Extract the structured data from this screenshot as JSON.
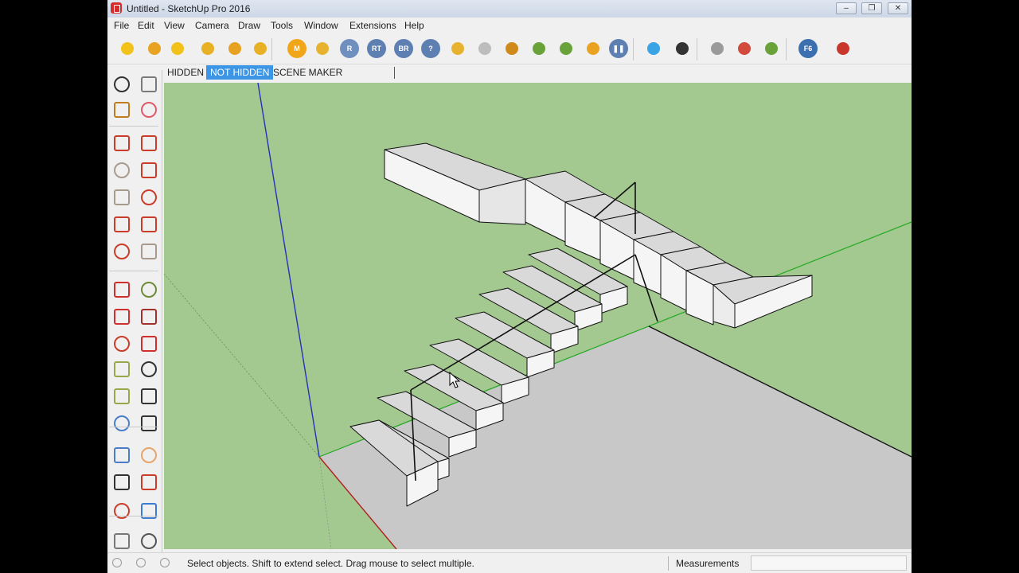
{
  "window": {
    "title": "Untitled - SketchUp Pro 2016",
    "controls": {
      "minimize": "–",
      "maximize": "❐",
      "close": "✕"
    }
  },
  "menu": [
    "File",
    "Edit",
    "View",
    "Camera",
    "Draw",
    "Tools",
    "Window",
    "Extensions",
    "Help"
  ],
  "toolbar": {
    "icons": [
      {
        "name": "sphere-icon",
        "color": "#f2c21b"
      },
      {
        "name": "layer-icon",
        "color": "#e9a323"
      },
      {
        "name": "tag-icon",
        "color": "#f2c21b"
      },
      {
        "name": "disc-icon",
        "color": "#e8b025"
      },
      {
        "name": "ball-icon",
        "color": "#e8a221"
      },
      {
        "name": "wand-icon",
        "color": "#e8b025"
      },
      {
        "name": "m-icon",
        "label": "M",
        "color": "#f1a61a"
      },
      {
        "name": "tag-gear-icon",
        "color": "#e7b32e"
      },
      {
        "name": "r-icon",
        "label": "R",
        "color": "#6f8fbf"
      },
      {
        "name": "rt-icon",
        "label": "RT",
        "color": "#5d7fb2"
      },
      {
        "name": "br-icon",
        "label": "BR",
        "color": "#5d7fb2"
      },
      {
        "name": "help-icon",
        "label": "?",
        "color": "#5d7fb2"
      },
      {
        "name": "tag-edit-icon",
        "color": "#e7b32e"
      },
      {
        "name": "light-icon",
        "color": "#bdbdbd"
      },
      {
        "name": "spark-icon",
        "color": "#cf8a1b"
      },
      {
        "name": "plant-icon",
        "color": "#6aa23a"
      },
      {
        "name": "plant-alt-icon",
        "color": "#6aa23a"
      },
      {
        "name": "target-icon",
        "color": "#e9a321"
      },
      {
        "name": "pause-icon",
        "label": "❚❚",
        "color": "#5d7fb2"
      },
      {
        "name": "color-grid-icon",
        "color": "#3aa3e6"
      },
      {
        "name": "select-arrow-icon",
        "color": "#333333"
      },
      {
        "name": "shell-icon",
        "color": "#9a9a9a"
      },
      {
        "name": "magnet-icon",
        "color": "#d14a3b"
      },
      {
        "name": "mesh-icon",
        "color": "#6aa23a"
      },
      {
        "name": "f6-icon",
        "label": "F6",
        "color": "#3b6fb0"
      },
      {
        "name": "book-icon",
        "color": "#c7372c"
      }
    ]
  },
  "scene_tabs": {
    "tabs": [
      "HIDDEN",
      "NOT HIDDEN",
      "SCENE MAKER"
    ],
    "active_index": 1
  },
  "left_tools": [
    {
      "name": "select-tool-icon"
    },
    {
      "name": "component-tool-icon"
    },
    {
      "name": "paint-bucket-icon"
    },
    {
      "name": "eraser-icon"
    },
    {
      "name": "pencil-icon"
    },
    {
      "name": "freehand-icon"
    },
    {
      "name": "rectangle-icon"
    },
    {
      "name": "rotated-rectangle-icon"
    },
    {
      "name": "circle-icon"
    },
    {
      "name": "polygon-icon"
    },
    {
      "name": "arc-icon"
    },
    {
      "name": "two-point-arc-icon"
    },
    {
      "name": "three-point-arc-icon"
    },
    {
      "name": "pie-icon"
    },
    {
      "name": "move-icon"
    },
    {
      "name": "push-pull-icon"
    },
    {
      "name": "rotate-icon"
    },
    {
      "name": "follow-me-icon"
    },
    {
      "name": "scale-icon"
    },
    {
      "name": "offset-icon"
    },
    {
      "name": "tape-measure-icon"
    },
    {
      "name": "dimension-icon"
    },
    {
      "name": "protractor-icon"
    },
    {
      "name": "text-icon"
    },
    {
      "name": "axes-icon"
    },
    {
      "name": "3d-text-icon"
    },
    {
      "name": "orbit-icon"
    },
    {
      "name": "pan-icon"
    },
    {
      "name": "zoom-icon"
    },
    {
      "name": "zoom-window-icon"
    },
    {
      "name": "zoom-extents-icon"
    },
    {
      "name": "previous-view-icon"
    },
    {
      "name": "position-camera-icon"
    },
    {
      "name": "look-around-icon"
    }
  ],
  "status": {
    "text": "Select objects. Shift to extend select. Drag mouse to select multiple.",
    "measurements_label": "Measurements",
    "measurements_value": ""
  },
  "colors": {
    "sky": "#a3c890",
    "ground": "#c8c8c8",
    "model_face": "#f5f5f5",
    "model_top": "#d9d9d9",
    "axis_blue": "#2432b8",
    "axis_green": "#1fa81f",
    "axis_red": "#b0201f",
    "active_tab": "#3d95e6"
  }
}
